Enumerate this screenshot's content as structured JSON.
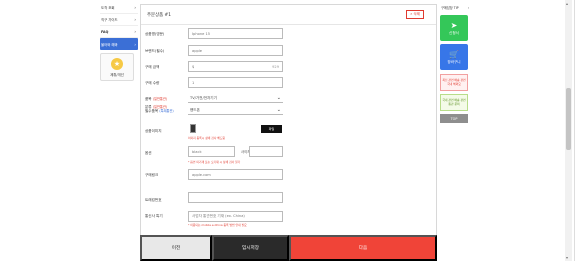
{
  "left_nav": {
    "items": [
      {
        "label": "도착 조회",
        "chev": "›"
      },
      {
        "label": "직구 가이드",
        "chev": "›"
      },
      {
        "label": "FAQ",
        "chev": "›"
      },
      {
        "label": "물어봐 해봐",
        "chev": "›"
      }
    ],
    "box_label": "제휴/개선"
  },
  "section": {
    "title": "주문상품 #1",
    "delete_label": "× 삭제"
  },
  "form": {
    "product_name_label": "상품명(영문)",
    "product_name_value": "Iphone 15",
    "brand_label": "브랜드(필수)",
    "brand_value": "apple",
    "price_label": "구매 금액",
    "price_currency": "$",
    "price_suffix": "929",
    "qty_label": "구매 수량",
    "qty_value": "1",
    "category_label": "품목",
    "category_value": "TV/가전/전자기기",
    "category_req": "(일반통관)",
    "subcat_label": "분류",
    "subcat_req": "(일반통관)",
    "subcat_sub": "필수품목",
    "subcat_sub2": "(특례통관)",
    "subcat_value": "핸드폰",
    "image_label": "상품이미지",
    "image_btn": "파일",
    "image_notice": "이미지 등록시 상세 검사 해드림",
    "option_label": "옵션",
    "option_color_placeholder": "black",
    "option_size_label": "사이즈",
    "option_notice": "* 옵션 미기재 또는 오기재 시 상세 검사 불가",
    "url_label": "구매링크",
    "url_value": "apple.com",
    "tracking_label": "트래킹번호",
    "memo_label": "통신사 특기",
    "memo_placeholder": "사업자 통관번호 기재 (ex. China)",
    "memo_notice": "* 이용되는 mobile·e-China 등록 방법 안내 필요"
  },
  "bottom": {
    "prev_label": "이전",
    "save_label": "임시저장",
    "next_label": "다음"
  },
  "right_nav": {
    "top_label": "구매담당 TIP",
    "card1_label": "신청서",
    "card2_label": "장바구니",
    "pink_label": "최신 관련 배송 관련 국내 해외요",
    "lgreen_label": "국내 관련 배송 관련 통관 문의",
    "top_btn_label": "TOP"
  }
}
